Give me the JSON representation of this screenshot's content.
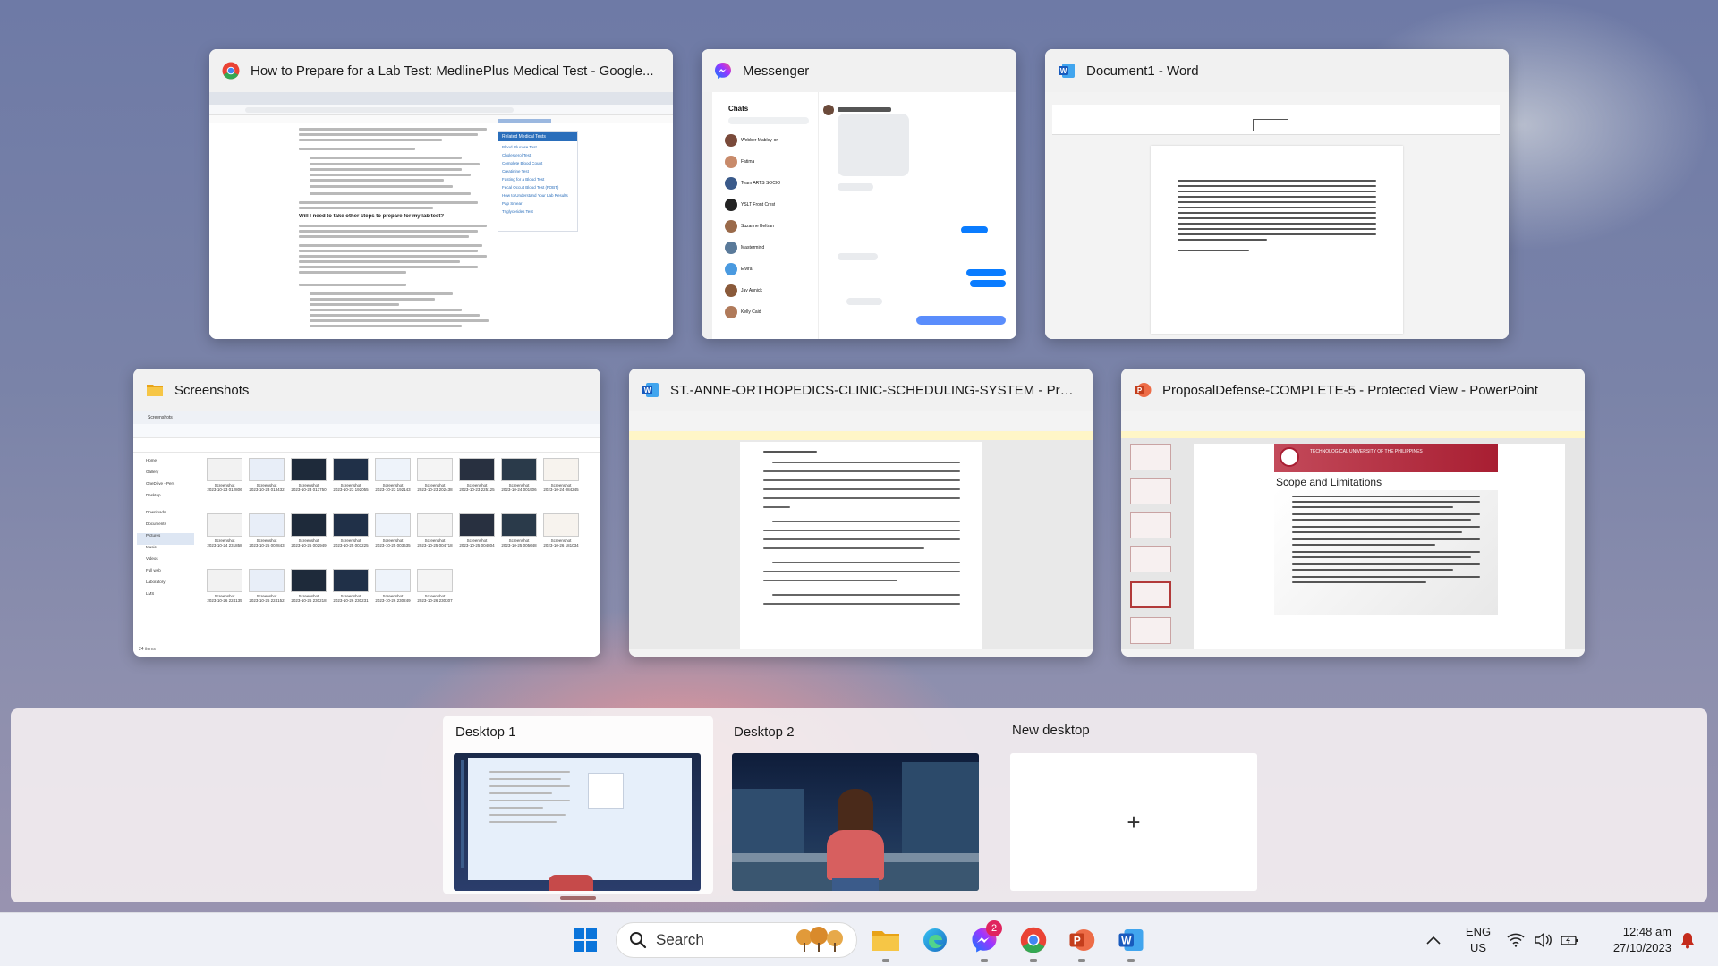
{
  "windows": [
    {
      "title": "How to Prepare for a Lab Test: MedlinePlus Medical Test - Google...",
      "app": "chrome"
    },
    {
      "title": "Messenger",
      "app": "messenger"
    },
    {
      "title": "Document1 - Word",
      "app": "word"
    },
    {
      "title": "Screenshots",
      "app": "explorer"
    },
    {
      "title": "ST.-ANNE-ORTHOPEDICS-CLINIC-SCHEDULING-SYSTEM  -  Protec...",
      "app": "word"
    },
    {
      "title": "ProposalDefense-COMPLETE-5  -  Protected View - PowerPoint",
      "app": "powerpoint"
    }
  ],
  "chrome_thumb": {
    "heading": "Will I need to take other steps to prepare for my lab test?",
    "sidebar_heading": "Related Medical Tests",
    "sidebar_items": [
      "Blood Glucose Test",
      "Cholesterol Test",
      "Complete Blood Count",
      "Creatinine Test",
      "Fasting for a Blood Test",
      "Fecal Occult Blood Test (FOBT)",
      "How to Understand Your Lab Results",
      "Pap Smear",
      "Triglycerides Test"
    ]
  },
  "messenger_thumb": {
    "header": "Chats",
    "chats": [
      "Webber Mabley-on",
      "Fatima",
      "Team ARTS SOCIO",
      "YSLT Front Crest",
      "Suzanne Beltran",
      "Mastermind",
      "Elvira",
      "Jay Annick",
      "Kelly Caid"
    ]
  },
  "ppt_thumb": {
    "slide_title": "Scope and Limitations",
    "org": "TECHNOLOGICAL UNIVERSITY OF THE PHILIPPINES"
  },
  "explorer_thumb": {
    "folder": "Screenshots",
    "nav_items": [
      "Home",
      "Gallery",
      "OneDrive - Pers",
      "Desktop",
      "Downloads",
      "Documents",
      "Pictures",
      "Music",
      "Videos",
      "Full web",
      "Laboratory",
      "LMS"
    ],
    "files": [
      "2023-10-23 012806",
      "2023-10-23 013432",
      "2023-10-23 013750",
      "2023-10-23 192055",
      "2023-10-23 192143",
      "2023-10-23 202438",
      "2023-10-23 225125",
      "2023-10-24 001906",
      "2023-10-24 084245",
      "2023-10-24 231858",
      "2023-10-25 002843",
      "2023-10-25 002949",
      "2023-10-25 003225",
      "2023-10-25 003635",
      "2023-10-25 004718",
      "2023-10-25 004804",
      "2023-10-25 005648",
      "2023-10-26 181034",
      "2023-10-26 224135",
      "2023-10-26 224152",
      "2023-10-26 230218",
      "2023-10-26 230231",
      "2023-10-26 230249",
      "2023-10-26 230307"
    ],
    "file_label": "Screenshot",
    "status": "24 items"
  },
  "desktops": [
    {
      "label": "Desktop 1",
      "active": true
    },
    {
      "label": "Desktop 2",
      "active": false
    }
  ],
  "new_desktop": {
    "label": "New desktop",
    "icon": "+"
  },
  "taskbar": {
    "search_placeholder": "Search",
    "messenger_badge": "2",
    "lang_top": "ENG",
    "lang_bottom": "US",
    "time": "12:48 am",
    "date": "27/10/2023"
  },
  "colors": {
    "word_blue": "#185abd",
    "ppt_red": "#c43e1c",
    "chrome_red": "#ea4335",
    "messenger": "#a033ff",
    "folder": "#f6c646"
  }
}
